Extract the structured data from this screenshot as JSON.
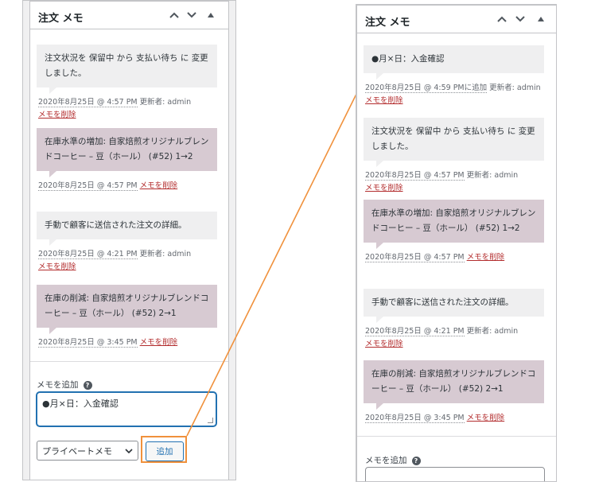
{
  "left": {
    "title": "注文 メモ",
    "notes": [
      {
        "type": "customer",
        "text": "注文状況を 保留中 から 支払い待ち に 変更しました。",
        "date": "2020年8月25日 @ 4:57 PM",
        "by": "更新者: admin",
        "delete": "メモを削除"
      },
      {
        "type": "system",
        "text": "在庫水準の増加: 自家焙煎オリジナルブレンドコーヒー – 豆（ホール） (#52) 1→2",
        "date": "2020年8月25日 @ 4:57 PM",
        "by": "",
        "delete": "メモを削除"
      },
      {
        "type": "customer",
        "text": "手動で顧客に送信された注文の詳細。",
        "date": "2020年8月25日 @ 4:21 PM",
        "by": "更新者: admin",
        "delete": "メモを削除"
      },
      {
        "type": "system",
        "text": "在庫の削減: 自家焙煎オリジナルブレンドコーヒー – 豆（ホール） (#52) 2→1",
        "date": "2020年8月25日 @ 3:45 PM",
        "by": "",
        "delete": "メモを削除"
      }
    ],
    "add_label": "メモを追加",
    "textarea_value": "●月×日：入金確認",
    "select_value": "プライベートメモ",
    "add_button": "追加"
  },
  "right": {
    "title": "注文 メモ",
    "notes": [
      {
        "type": "customer",
        "text": "●月×日：入金確認",
        "date": "2020年8月25日 @ 4:59 PMに追加",
        "by": "更新者: admin",
        "delete": "メモを削除"
      },
      {
        "type": "customer",
        "text": "注文状況を 保留中 から 支払い待ち に 変更しました。",
        "date": "2020年8月25日 @ 4:57 PM",
        "by": "更新者: admin",
        "delete": "メモを削除"
      },
      {
        "type": "system",
        "text": "在庫水準の増加: 自家焙煎オリジナルブレンドコーヒー – 豆（ホール） (#52) 1→2",
        "date": "2020年8月25日 @ 4:57 PM",
        "by": "",
        "delete": "メモを削除"
      },
      {
        "type": "customer",
        "text": "手動で顧客に送信された注文の詳細。",
        "date": "2020年8月25日 @ 4:21 PM",
        "by": "更新者: admin",
        "delete": "メモを削除"
      },
      {
        "type": "system",
        "text": "在庫の削減: 自家焙煎オリジナルブレンドコーヒー – 豆（ホール） (#52) 2→1",
        "date": "2020年8月25日 @ 3:45 PM",
        "by": "",
        "delete": "メモを削除"
      }
    ],
    "add_label": "メモを追加"
  },
  "icons": {
    "up": "chevron-up-icon",
    "down": "chevron-down-icon",
    "toggle": "triangle-up-icon",
    "help": "help-icon"
  },
  "colors": {
    "system_note_bg": "#d7cad2",
    "note_bg": "#efeff0",
    "delete_link": "#b32d2e",
    "accent": "#2271b1",
    "highlight": "#f0913c"
  }
}
